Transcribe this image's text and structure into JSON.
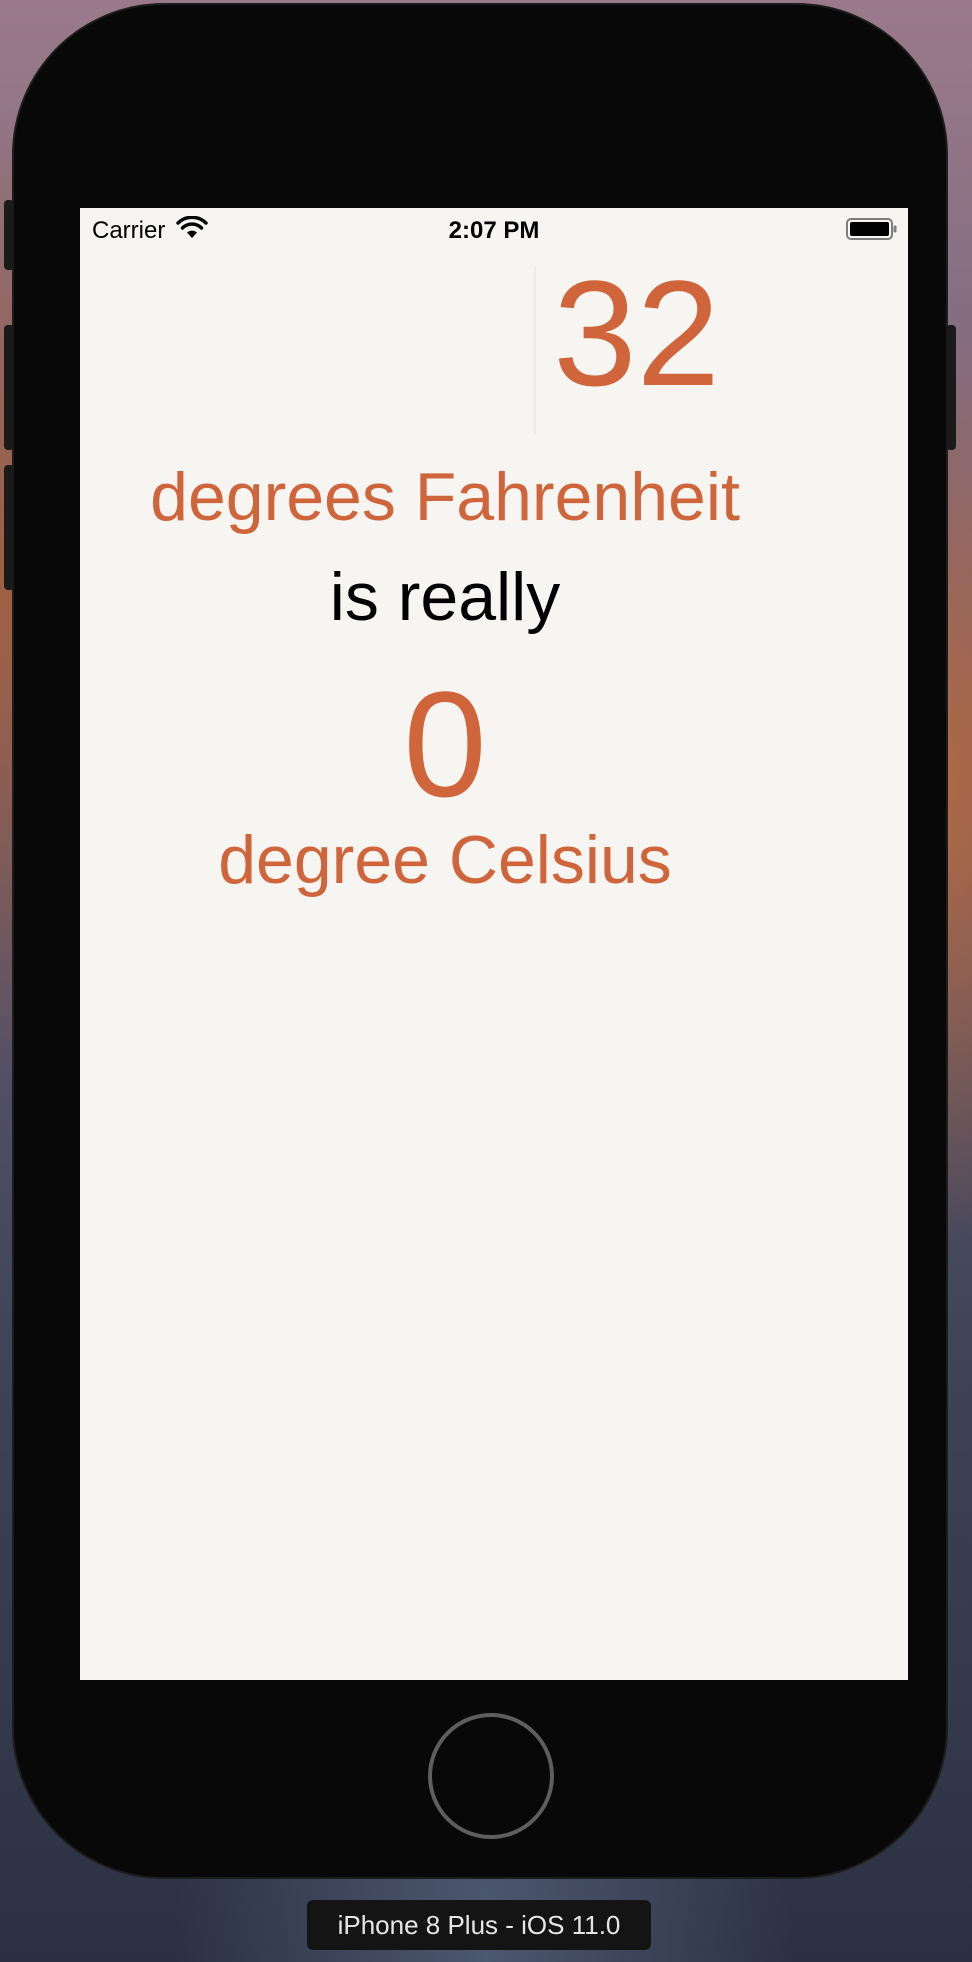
{
  "simulator": {
    "device_label": "iPhone 8 Plus - iOS 11.0"
  },
  "status_bar": {
    "carrier": "Carrier",
    "time": "2:07 PM",
    "wifi_icon": "wifi-icon",
    "battery_icon": "battery-icon"
  },
  "converter": {
    "fahrenheit_value": "32",
    "fahrenheit_label": "degrees Fahrenheit",
    "connector": "is really",
    "celsius_value": "0",
    "celsius_label": "degree Celsius"
  },
  "colors": {
    "accent": "#d0643b",
    "background": "#f6f5f2",
    "text": "#000000"
  }
}
